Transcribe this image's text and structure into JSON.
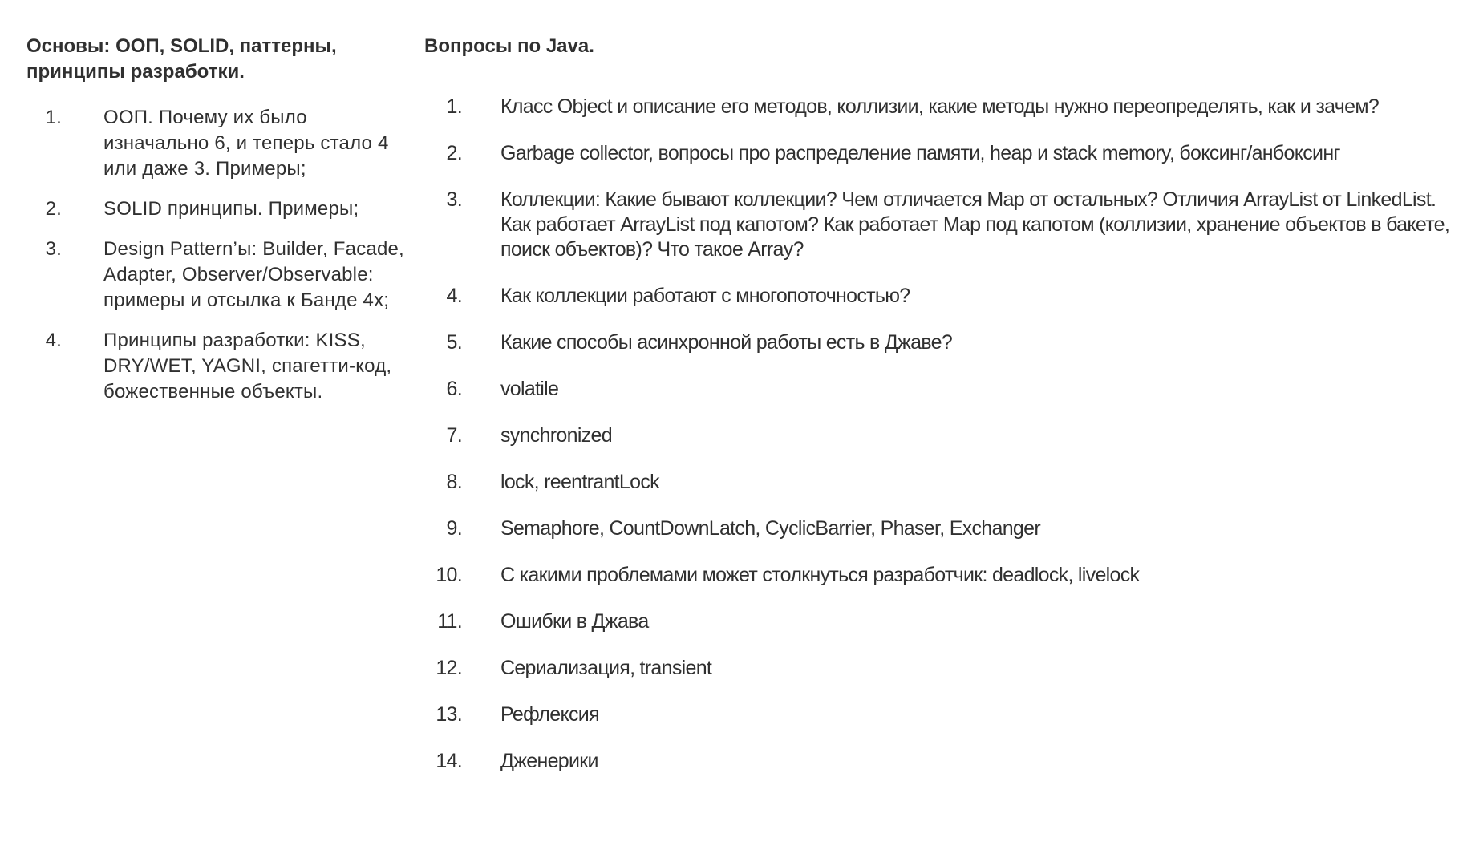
{
  "left": {
    "heading": "Основы: ООП, SOLID, паттерны, принципы разработки.",
    "items": [
      {
        "num": "1.",
        "text": "ООП. Почему их было изначально 6, и теперь стало 4 или даже 3. Примеры;"
      },
      {
        "num": "2.",
        "text": "SOLID принципы. Примеры;"
      },
      {
        "num": "3.",
        "text": "Design Pattern’ы: Builder, Facade, Adapter, Observer/Observable: примеры и отсылка к Банде 4х;"
      },
      {
        "num": "4.",
        "text": "Принципы разработки: KISS, DRY/WET, YAGNI, спагетти-код, божественные объекты."
      }
    ]
  },
  "right": {
    "heading": "Вопросы по Java.",
    "items": [
      {
        "num": "1.",
        "text": "Класс Object и описание его методов, коллизии, какие методы нужно переопределять, как и зачем?"
      },
      {
        "num": "2.",
        "text": "Garbage collector, вопросы про распределение памяти, heap и stack memory, боксинг/анбоксинг"
      },
      {
        "num": "3.",
        "text": "Коллекции: Какие бывают коллекции? Чем отличается Map от остальных? Отличия ArrayList от LinkedList. Как работает ArrayList под капотом? Как работает Map под капотом (коллизии, хранение объектов в бакете, поиск объектов)? Что такое Array?"
      },
      {
        "num": "4.",
        "text": "Как коллекции работают с многопоточностью?"
      },
      {
        "num": "5.",
        "text": "Какие способы асинхронной работы есть в Джаве?"
      },
      {
        "num": "6.",
        "text": "volatile"
      },
      {
        "num": "7.",
        "text": "synchronized"
      },
      {
        "num": "8.",
        "text": "lock, reentrantLock"
      },
      {
        "num": "9.",
        "text": "Semaphore, CountDownLatch, CyclicBarrier, Phaser, Exchanger"
      },
      {
        "num": "10.",
        "text": "С какими проблемами может столкнуться разработчик: deadlock, livelock"
      },
      {
        "num": "11.",
        "text": "Ошибки в Джава"
      },
      {
        "num": "12.",
        "text": "Сериализация, transient"
      },
      {
        "num": "13.",
        "text": "Рефлексия"
      },
      {
        "num": "14.",
        "text": "Дженерики"
      }
    ]
  }
}
